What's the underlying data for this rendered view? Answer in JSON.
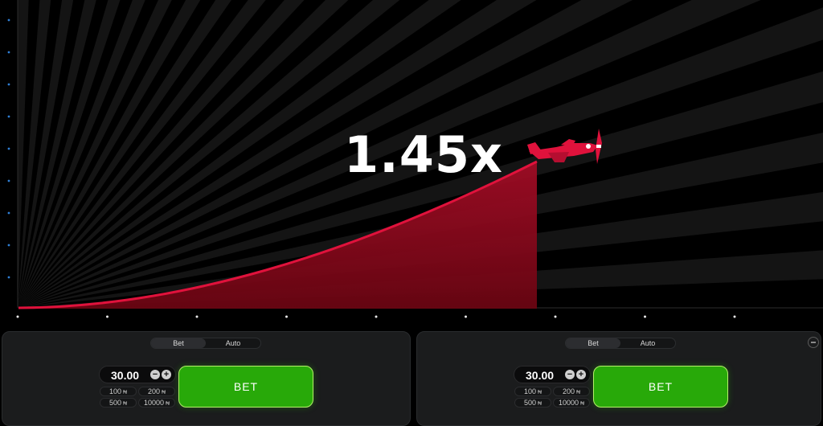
{
  "game": {
    "multiplier": "1.45x",
    "plane_color": "#e0123c"
  },
  "panels": [
    {
      "tabs": [
        "Bet",
        "Auto"
      ],
      "active_tab": "Bet",
      "amount": "30.00",
      "quick_amounts": [
        "100",
        "200",
        "500",
        "10000"
      ],
      "currency": "₦",
      "bet_label": "BET"
    },
    {
      "tabs": [
        "Bet",
        "Auto"
      ],
      "active_tab": "Bet",
      "amount": "30.00",
      "quick_amounts": [
        "100",
        "200",
        "500",
        "10000"
      ],
      "currency": "₦",
      "bet_label": "BET"
    }
  ],
  "colors": {
    "bet_button": "#28a909",
    "curve": "#e0123c",
    "background": "#000000"
  }
}
